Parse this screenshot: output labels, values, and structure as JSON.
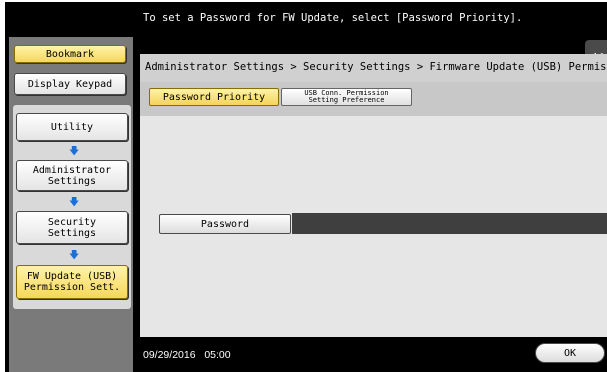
{
  "message": "To set a Password for FW Update, select [Password Priority].",
  "sidebar": {
    "bookmark": "Bookmark",
    "display_keypad": "Display Keypad",
    "path": [
      {
        "label": "Utility"
      },
      {
        "label_l1": "Administrator",
        "label_l2": "Settings"
      },
      {
        "label_l1": "Security",
        "label_l2": "Settings"
      },
      {
        "label_l1": "FW Update (USB)",
        "label_l2": "Permission Sett."
      }
    ]
  },
  "breadcrumb": "Administrator Settings > Security Settings > Firmware Update (USB) Permiss",
  "tabs": {
    "password_priority": "Password Priority",
    "usb_conn_l1": "USB Conn. Permission",
    "usb_conn_l2": "Setting Preference"
  },
  "password_label": "Password",
  "password_value": "",
  "footer": {
    "date": "09/29/2016",
    "time": "05:00",
    "ok": "OK"
  },
  "icons": {
    "back": "double-chevron-left-icon",
    "path_arrow": "arrow-down-icon"
  },
  "colors": {
    "selected": "#f5d75a",
    "arrow": "#1a6fd8"
  }
}
